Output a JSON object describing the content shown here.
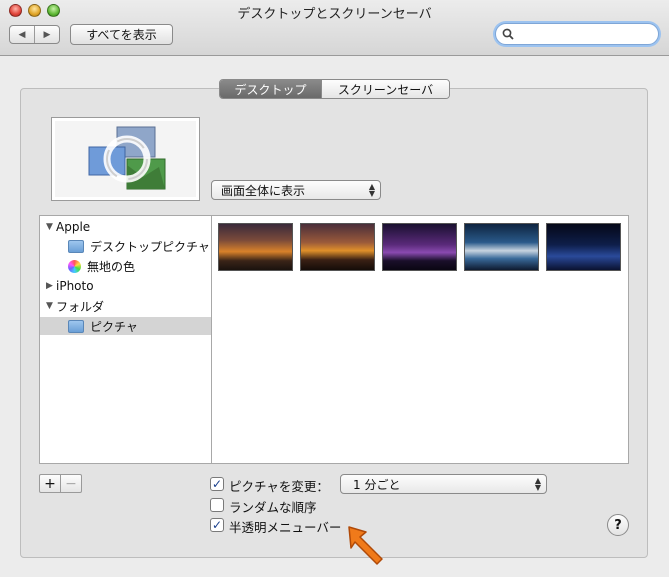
{
  "window": {
    "title": "デスクトップとスクリーンセーバ"
  },
  "toolbar": {
    "back_label": "◀",
    "forward_label": "▶",
    "show_all_label": "すべてを表示",
    "search_placeholder": ""
  },
  "tabs": [
    {
      "label": "デスクトップ",
      "selected": true
    },
    {
      "label": "スクリーンセーバ",
      "selected": false
    }
  ],
  "fill_mode": {
    "selected": "画面全体に表示"
  },
  "sidebar": {
    "items": [
      {
        "label": "Apple",
        "type": "group",
        "expanded": true
      },
      {
        "label": "デスクトップピクチャ",
        "type": "folder"
      },
      {
        "label": "無地の色",
        "type": "colors"
      },
      {
        "label": "iPhoto",
        "type": "group",
        "expanded": false
      },
      {
        "label": "フォルダ",
        "type": "group",
        "expanded": true
      },
      {
        "label": "ピクチャ",
        "type": "folder",
        "selected": true
      }
    ]
  },
  "thumbnails": [
    {
      "name": "sunset-1"
    },
    {
      "name": "sunset-2"
    },
    {
      "name": "purple-dusk"
    },
    {
      "name": "wing-clouds"
    },
    {
      "name": "night-sky"
    }
  ],
  "list_buttons": {
    "add": "+",
    "remove": "−"
  },
  "options": {
    "change_picture": {
      "label": "ピクチャを変更：",
      "checked": true
    },
    "interval": {
      "selected": "1 分ごと"
    },
    "random_order": {
      "label": "ランダムな順序",
      "checked": false
    },
    "translucent_menu": {
      "label": "半透明メニューバー",
      "checked": true
    }
  },
  "help": {
    "label": "?"
  },
  "colors": {
    "accent": "#9cc3f0",
    "selected_tab": "#6f6f6f",
    "arrow": "#f07a1a"
  }
}
